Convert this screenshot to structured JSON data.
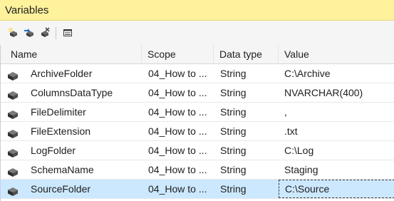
{
  "window": {
    "title": "Variables"
  },
  "toolbar": {
    "buttons": [
      {
        "name": "add-variable-icon"
      },
      {
        "name": "move-variable-icon"
      },
      {
        "name": "delete-variable-icon"
      },
      {
        "name": "grid-options-icon"
      }
    ]
  },
  "grid": {
    "columns": [
      "Name",
      "Scope",
      "Data type",
      "Value"
    ],
    "rows": [
      {
        "name": "ArchiveFolder",
        "scope": "04_How to ...",
        "type": "String",
        "value": "C:\\Archive",
        "selected": false
      },
      {
        "name": "ColumnsDataType",
        "scope": "04_How to ...",
        "type": "String",
        "value": "NVARCHAR(400)",
        "selected": false
      },
      {
        "name": "FileDelimiter",
        "scope": "04_How to ...",
        "type": "String",
        "value": ",",
        "selected": false
      },
      {
        "name": "FileExtension",
        "scope": "04_How to ...",
        "type": "String",
        "value": ".txt",
        "selected": false
      },
      {
        "name": "LogFolder",
        "scope": "04_How to ...",
        "type": "String",
        "value": "C:\\Log",
        "selected": false
      },
      {
        "name": "SchemaName",
        "scope": "04_How to ...",
        "type": "String",
        "value": "Staging",
        "selected": false
      },
      {
        "name": "SourceFolder",
        "scope": "04_How to ...",
        "type": "String",
        "value": "C:\\Source",
        "selected": true
      }
    ]
  },
  "colors": {
    "title_bar": "#fff29d",
    "selected_row": "#cce8ff"
  }
}
